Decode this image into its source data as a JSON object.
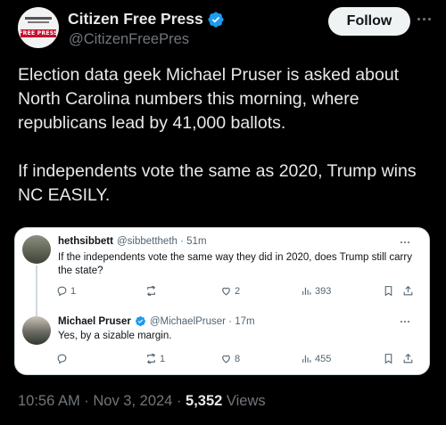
{
  "post": {
    "author": {
      "name": "Citizen Free Press",
      "handle": "@CitizenFreePres",
      "avatar_text": "FREE PRESS"
    },
    "follow_label": "Follow",
    "paragraphs": [
      "Election data geek Michael Pruser is asked about North Carolina numbers this morning, where republicans lead by 41,000 ballots.",
      "If independents vote the same as 2020, Trump wins NC EASILY."
    ],
    "timestamp": "10:56 AM · Nov 3, 2024 · ",
    "views_count": "5,352",
    "views_label": " Views"
  },
  "quoted_thread": {
    "replies": [
      {
        "name": "hethsibbett",
        "handle": "@sibbettheth",
        "time": "· 51m",
        "verified": false,
        "text": "If the independents vote the same way they did in 2020, does Trump still carry the state?",
        "replies_count": "1",
        "reposts_count": "",
        "likes_count": "2",
        "views_count": "393"
      },
      {
        "name": "Michael Pruser",
        "handle": "@MichaelPruser",
        "time": "· 17m",
        "verified": true,
        "text": "Yes, by a sizable margin.",
        "replies_count": "",
        "reposts_count": "1",
        "likes_count": "8",
        "views_count": "455"
      }
    ]
  },
  "colors": {
    "verified_blue": "#1d9bf0",
    "background": "#000000",
    "muted": "#71767b"
  },
  "icons": [
    "verified-badge-icon",
    "more-icon",
    "reply-icon",
    "repost-icon",
    "like-icon",
    "views-icon",
    "bookmark-icon",
    "share-icon"
  ]
}
